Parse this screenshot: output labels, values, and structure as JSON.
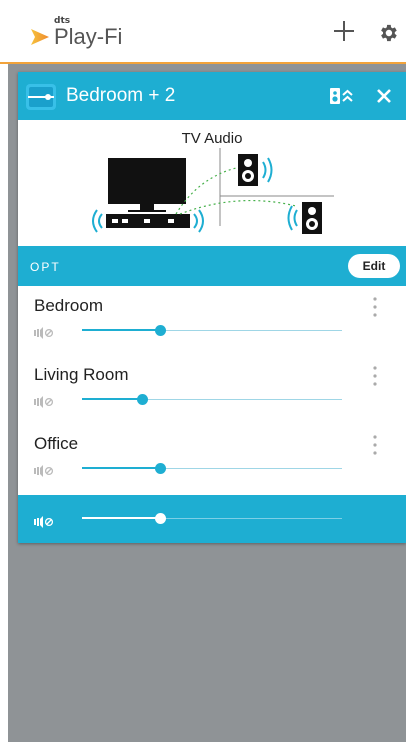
{
  "app": {
    "brand_small": "dts",
    "brand_name": "Play-Fi",
    "accent": "#f2a33a"
  },
  "card": {
    "title": "Bedroom + 2",
    "header_color": "#1eaed2"
  },
  "source": {
    "title": "TV Audio"
  },
  "input": {
    "label": "OPT",
    "edit_label": "Edit"
  },
  "rooms": [
    {
      "name": "Bedroom",
      "volume": 0.3
    },
    {
      "name": "Living Room",
      "volume": 0.23
    },
    {
      "name": "Office",
      "volume": 0.3
    }
  ],
  "master": {
    "volume": 0.3
  },
  "icons": [
    "play-logo-icon",
    "plus-icon",
    "gear-icon",
    "speaker-group-icon",
    "collapse-icon",
    "close-icon",
    "kebab-menu-icon",
    "mute-icon"
  ]
}
